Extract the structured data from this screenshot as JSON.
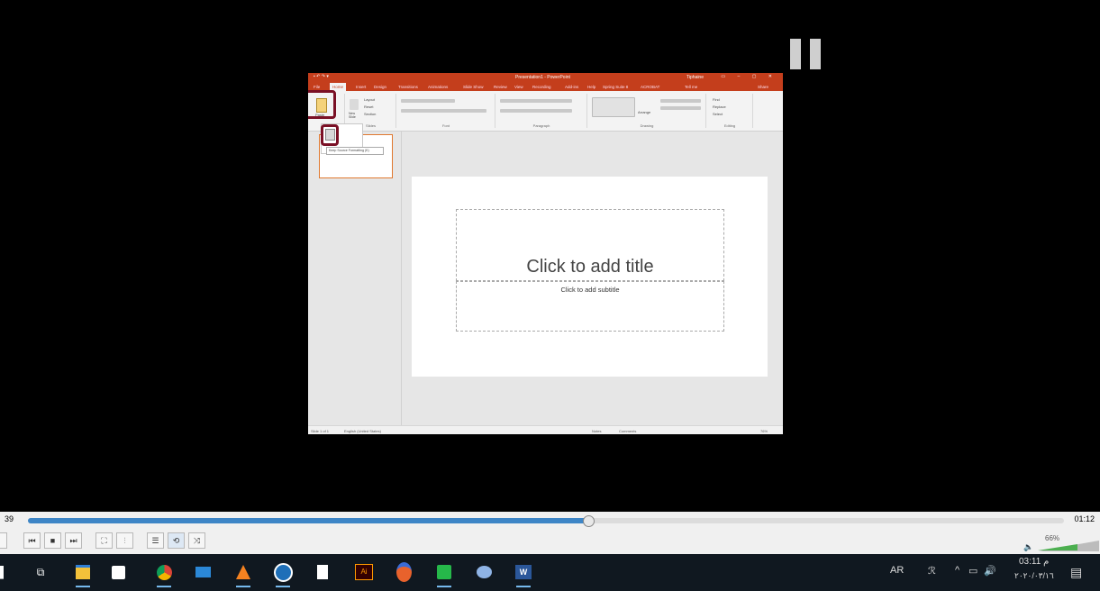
{
  "player": {
    "time_elapsed": "39",
    "time_total": "01:12",
    "progress": 0.54,
    "volume_label": "66%",
    "volume": 0.66
  },
  "powerpoint": {
    "window_title": "Presentation1 - PowerPoint",
    "user_name": "Tiphaine",
    "tabs": [
      "File",
      "Home",
      "Insert",
      "Design",
      "Transitions",
      "Animations",
      "Slide Show",
      "Review",
      "View",
      "Recording",
      "Add-ins",
      "Help",
      "Spring Suite 8",
      "ACROBAT",
      "Tell me",
      "Share"
    ],
    "active_tab": "Home",
    "ribbon_groups": [
      "Slides",
      "Font",
      "Paragraph",
      "Drawing",
      "Editing"
    ],
    "paste_label": "Paste",
    "slide_commands": [
      "Layout",
      "Reset",
      "Section"
    ],
    "new_slide_label": "New Slide",
    "editing_commands": [
      "Find",
      "Replace",
      "Select"
    ],
    "arrange_label": "Arrange",
    "tooltip": "Keep Source Formatting (K)",
    "slide_title_placeholder": "Click to add title",
    "slide_subtitle_placeholder": "Click to add subtitle",
    "status_slide": "Slide 1 of 1",
    "status_language": "English (United States)",
    "status_notes": "Notes",
    "status_comments": "Comments",
    "status_zoom": "76%"
  },
  "taskbar": {
    "language": "AR",
    "clock_time": "03:11 م",
    "clock_date": "٢٠٢٠/٠٣/١٦",
    "apps": [
      "task-view",
      "file-explorer",
      "store",
      "chrome",
      "mail",
      "vlc",
      "app-circle",
      "notepad",
      "illustrator",
      "app-orange",
      "camtasia",
      "paint",
      "word"
    ]
  }
}
